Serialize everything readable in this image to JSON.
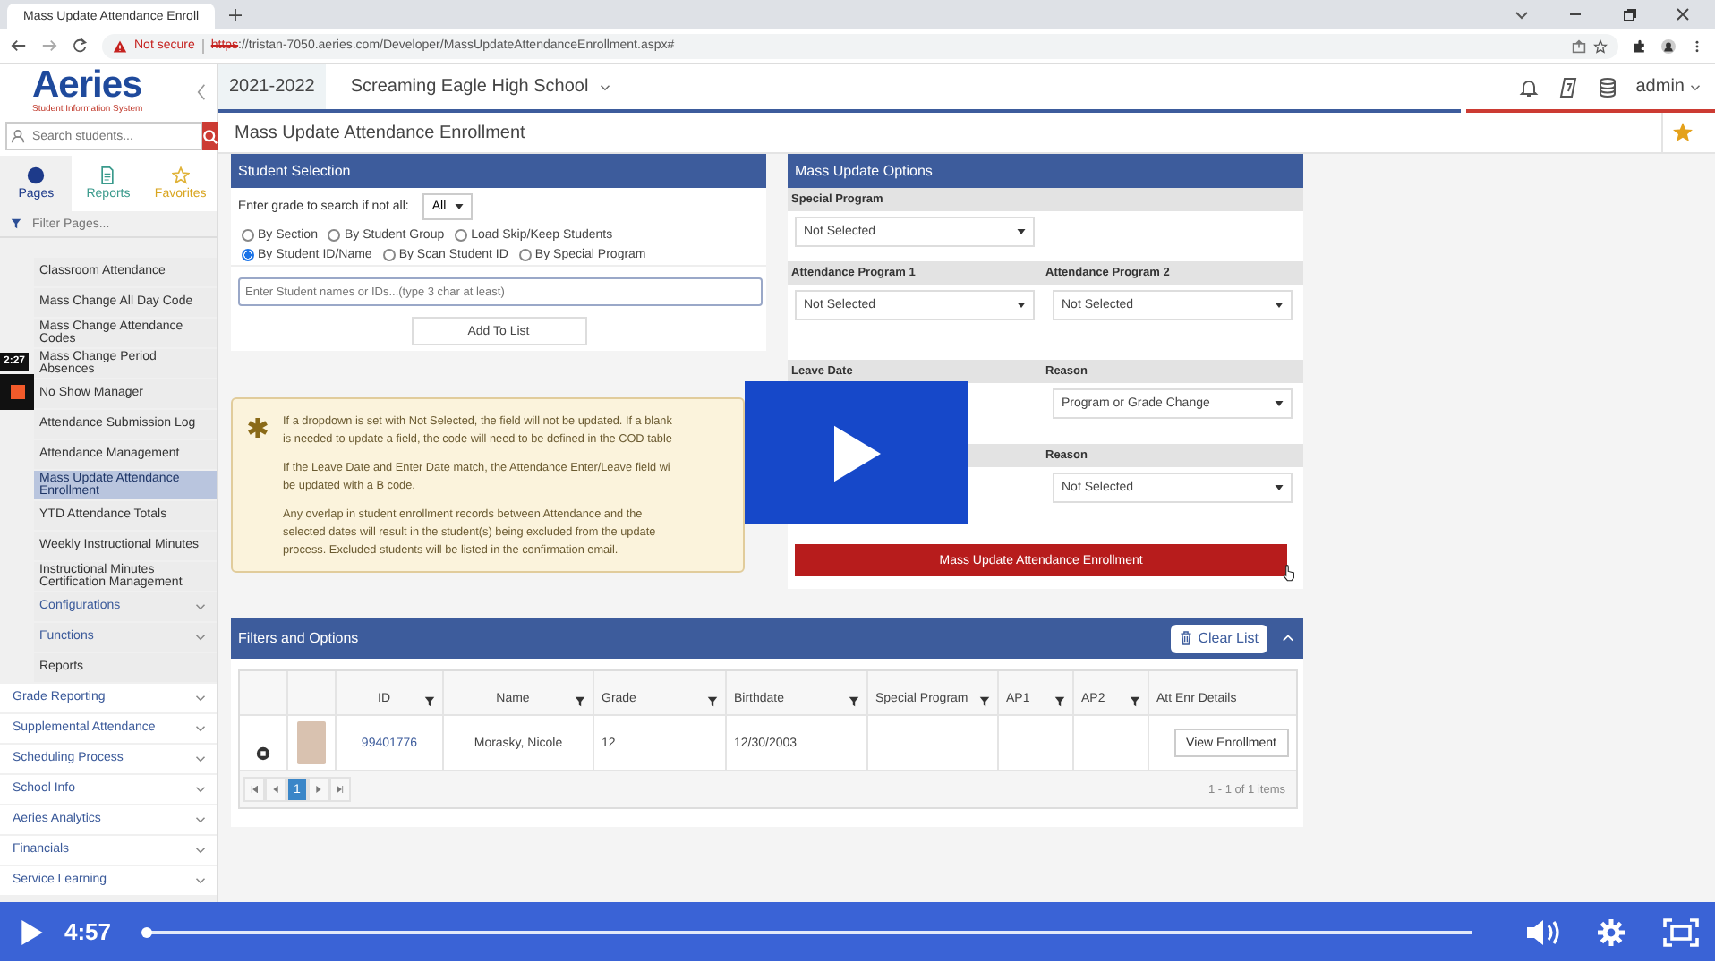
{
  "browser": {
    "tab_title": "Mass Update Attendance Enroll",
    "security": "Not secure",
    "url_scheme": "https",
    "url_rest": "://tristan-7050.aeries.com/Developer/MassUpdateAttendanceEnrollment.aspx#"
  },
  "sidebar": {
    "logo": "Aeries",
    "logo_sub": "Student Information System",
    "search_placeholder": "Search students...",
    "tabs": [
      {
        "label": "Pages",
        "selected": true
      },
      {
        "label": "Reports",
        "selected": false
      },
      {
        "label": "Favorites",
        "selected": false
      }
    ],
    "filter_placeholder": "Filter Pages...",
    "items": [
      {
        "label": "Classroom Attendance",
        "kind": "sub",
        "selected": false,
        "expandable": false
      },
      {
        "label": "Mass Change All Day Code",
        "kind": "sub",
        "selected": false,
        "expandable": false
      },
      {
        "label": "Mass Change Attendance Codes",
        "kind": "sub",
        "selected": false,
        "expandable": false
      },
      {
        "label": "Mass Change Period Absences",
        "kind": "sub",
        "selected": false,
        "expandable": false
      },
      {
        "label": "No Show Manager",
        "kind": "sub",
        "selected": false,
        "expandable": false
      },
      {
        "label": "Attendance Submission Log",
        "kind": "sub",
        "selected": false,
        "expandable": false
      },
      {
        "label": "Attendance Management",
        "kind": "sub",
        "selected": false,
        "expandable": false
      },
      {
        "label": "Mass Update Attendance Enrollment",
        "kind": "sub",
        "selected": true,
        "expandable": false
      },
      {
        "label": "YTD Attendance Totals",
        "kind": "sub",
        "selected": false,
        "expandable": false
      },
      {
        "label": "Weekly Instructional Minutes",
        "kind": "sub",
        "selected": false,
        "expandable": false
      },
      {
        "label": "Instructional Minutes Certification Management",
        "kind": "sub",
        "selected": false,
        "expandable": false
      },
      {
        "label": "Configurations",
        "kind": "group",
        "selected": false,
        "expandable": true
      },
      {
        "label": "Functions",
        "kind": "group",
        "selected": false,
        "expandable": true
      },
      {
        "label": "Reports",
        "kind": "sub",
        "selected": false,
        "expandable": false
      },
      {
        "label": "Grade Reporting",
        "kind": "section",
        "selected": false,
        "expandable": true
      },
      {
        "label": "Supplemental Attendance",
        "kind": "section",
        "selected": false,
        "expandable": true
      },
      {
        "label": "Scheduling Process",
        "kind": "section",
        "selected": false,
        "expandable": true
      },
      {
        "label": "School Info",
        "kind": "section",
        "selected": false,
        "expandable": true
      },
      {
        "label": "Aeries Analytics",
        "kind": "section",
        "selected": false,
        "expandable": true
      },
      {
        "label": "Financials",
        "kind": "section",
        "selected": false,
        "expandable": true
      },
      {
        "label": "Service Learning",
        "kind": "section",
        "selected": false,
        "expandable": true
      }
    ]
  },
  "header": {
    "year": "2021-2022",
    "school": "Screaming Eagle High School",
    "user": "admin"
  },
  "page_title": "Mass Update Attendance Enrollment",
  "student_selection": {
    "title": "Student Selection",
    "grade_label": "Enter grade to search if not all:",
    "grade_value": "All",
    "radios": [
      {
        "label": "By Section",
        "selected": false
      },
      {
        "label": "By Student Group",
        "selected": false
      },
      {
        "label": "Load Skip/Keep Students",
        "selected": false
      },
      {
        "label": "By Student ID/Name",
        "selected": true
      },
      {
        "label": "By Scan Student ID",
        "selected": false
      },
      {
        "label": "By Special Program",
        "selected": false
      }
    ],
    "search_placeholder": "Enter Student names or IDs...(type 3 char at least)",
    "add_button": "Add To List"
  },
  "notice": {
    "paragraphs": [
      [
        "If a dropdown is set with Not Selected, the field will not be updated. If a blank",
        "is needed to update a field, the code will need to be defined in the COD table"
      ],
      [
        "If the Leave Date and Enter Date match, the Attendance Enter/Leave field wi",
        "be updated with a B code."
      ],
      [
        "Any overlap in student enrollment records between Attendance and the",
        "selected dates will result in the student(s) being excluded from the update",
        "process. Excluded students will be listed in the confirmation email."
      ]
    ]
  },
  "options": {
    "title": "Mass Update Options",
    "sections": [
      {
        "fields": [
          {
            "label": "Special Program",
            "value": "Not Selected"
          }
        ]
      },
      {
        "fields": [
          {
            "label": "Attendance Program 1",
            "value": "Not Selected"
          },
          {
            "label": "Attendance Program 2",
            "value": "Not Selected"
          }
        ]
      },
      {
        "fields": [
          {
            "label": "Leave Date"
          },
          {
            "label": "Reason",
            "value": "Program or Grade Change"
          }
        ]
      },
      {
        "kind": "right",
        "fields": [
          {
            "label": "Reason",
            "value": "Not Selected"
          }
        ]
      }
    ],
    "submit_button": "Mass Update Attendance Enrollment"
  },
  "filters": {
    "title": "Filters and Options",
    "clear_button": "Clear List",
    "columns": [
      {
        "label": "ID",
        "filter": true
      },
      {
        "label": "Name",
        "filter": true
      },
      {
        "label": "Grade",
        "filter": true
      },
      {
        "label": "Birthdate",
        "filter": true
      },
      {
        "label": "Special Program",
        "filter": true
      },
      {
        "label": "AP1",
        "filter": true
      },
      {
        "label": "AP2",
        "filter": true
      },
      {
        "label": "Att Enr Details",
        "filter": false
      }
    ],
    "rows": [
      {
        "id": "99401776",
        "name": "Morasky, Nicole",
        "grade": "12",
        "birthdate": "12/30/2003",
        "action": "View Enrollment"
      }
    ],
    "pages": [
      {
        "label": "1",
        "selected": true
      }
    ],
    "summary": "1 - 1 of 1 items"
  },
  "video": {
    "marker_time": "2:27",
    "time": "4:57",
    "level": 0.0
  }
}
